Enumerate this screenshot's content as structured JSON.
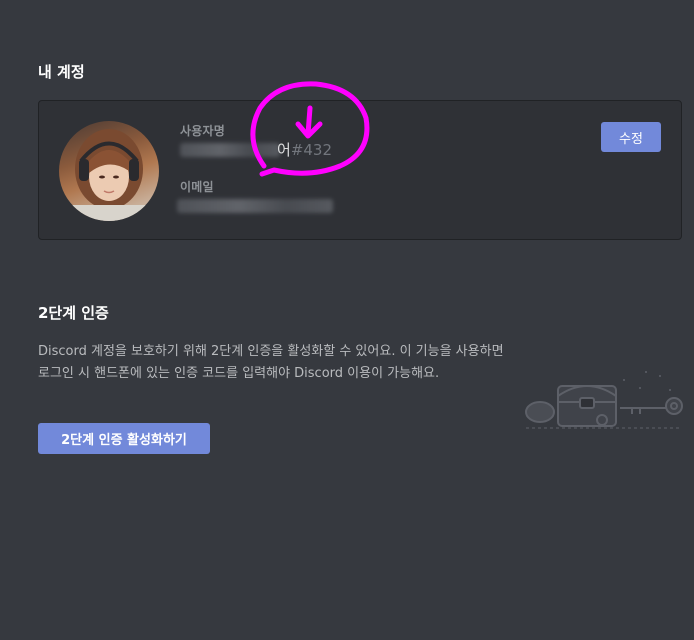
{
  "account": {
    "title": "내 계정",
    "username_label": "사용자명",
    "username_visible": "어",
    "username_tag": "#432",
    "email_label": "이메일",
    "edit_button": "수정"
  },
  "two_factor": {
    "title": "2단계 인증",
    "description": "Discord 계정을 보호하기 위해 2단계 인증을 활성화할 수 있어요. 이 기능을 사용하면 로그인 시 핸드폰에 있는 인증 코드를 입력해야 Discord 이용이 가능해요.",
    "enable_button": "2단계 인증 활성화하기"
  },
  "colors": {
    "background": "#36393f",
    "card": "#2f3136",
    "accent": "#7289da",
    "annotation": "#ff00ff"
  },
  "icons": {
    "annotation": "magenta-circle-arrow-icon",
    "illustration": "treasure-chest-key-illustration-icon"
  }
}
